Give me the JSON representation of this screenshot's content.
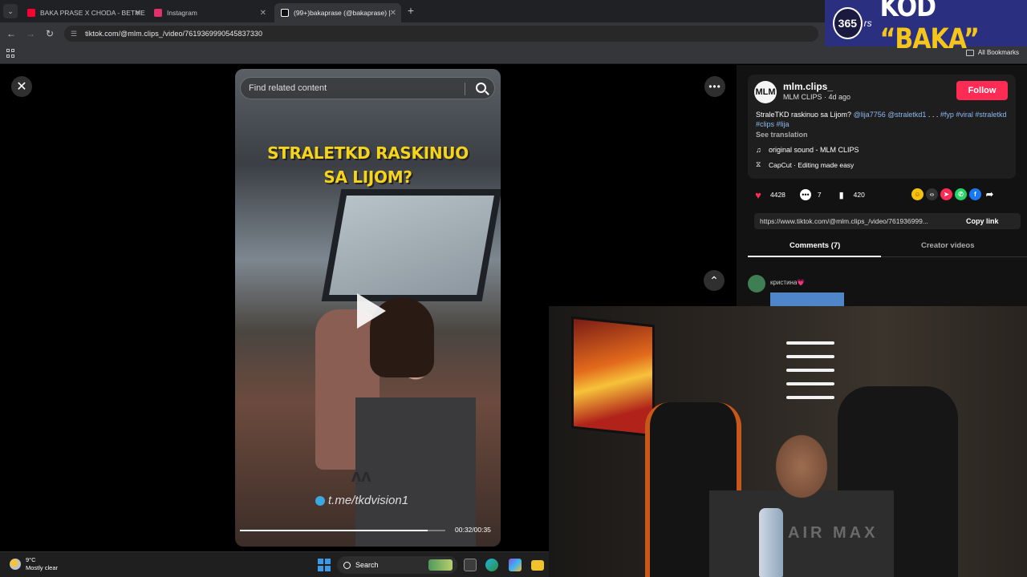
{
  "browser": {
    "tabs": [
      {
        "title": "BAKA PRASE X CHODA - BETME",
        "favicon_color": "#ff0033",
        "active": false
      },
      {
        "title": "Instagram",
        "favicon_color": "#e1306c",
        "active": false
      },
      {
        "title": "(99+)bakaprase (@bakaprase) |",
        "favicon_color": "#ffffff",
        "active": true
      }
    ],
    "url": "tiktok.com/@mlm.clips_/video/7619369990545837330",
    "bookmarks_label": "All Bookmarks"
  },
  "ad": {
    "logo": "365",
    "rs": "rs",
    "code_prefix": "KOD ",
    "code_word": "“BAKA”"
  },
  "video": {
    "search_placeholder": "Find related content",
    "caption_line1": "STRALETKD RASKINUO",
    "caption_line2": "SA LIJOM?",
    "watermark": "t.me/tkdvision1",
    "time": "00:32/00:35",
    "progress_fraction": 0.914
  },
  "post": {
    "avatar_initials": "MLM",
    "username": "mlm.clips_",
    "subline": "MLM CLIPS · 4d ago",
    "follow_label": "Follow",
    "description_text": "StraleTKD raskinuo sa Lijom? ",
    "description_tags_1": "@lija7756 @straletkd1",
    "description_mid": " . . . ",
    "description_tags_2": "#fyp #viral #straletkd #clips #lija",
    "see_translation": "See translation",
    "sound": "original sound - MLM CLIPS",
    "capcut": "CapCut · Editing made easy",
    "likes": "4428",
    "comments": "7",
    "saves": "420",
    "share_icons": [
      "yellow-emoji-icon",
      "embed-icon",
      "send-icon",
      "whatsapp-icon",
      "facebook-icon",
      "share-arrow-icon"
    ],
    "link": "https://www.tiktok.com/@mlm.clips_/video/761936999...",
    "copy_link_label": "Copy link",
    "tab_comments": "Comments (7)",
    "tab_creator": "Creator videos",
    "first_commenter": "кристина💗"
  },
  "webcam": {
    "shirt_text": "AIR MAX"
  },
  "taskbar": {
    "temperature": "9°C",
    "weather": "Mostly clear",
    "search_label": "Search"
  },
  "colors": {
    "follow": "#fe2c55",
    "caption": "#f6d41c",
    "ad_bg": "#2a2f80"
  }
}
